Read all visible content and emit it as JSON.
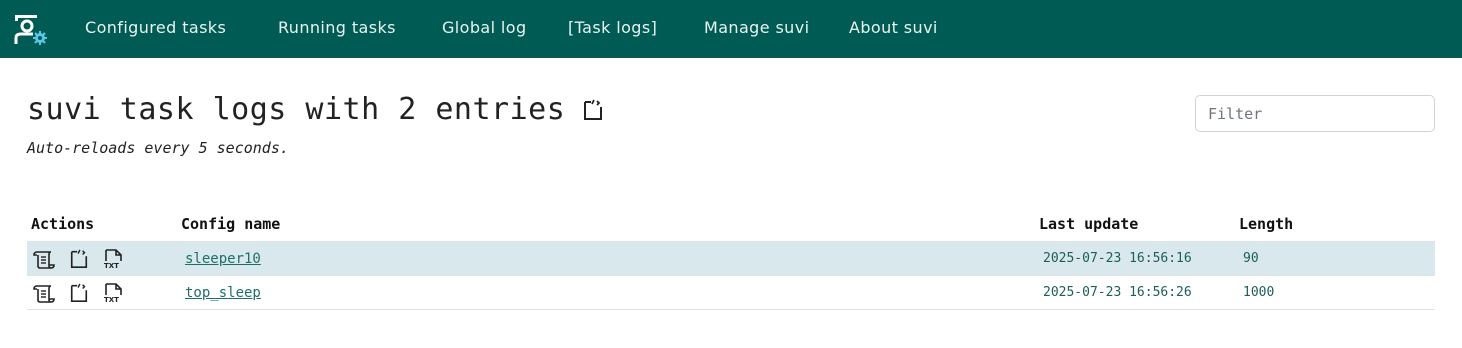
{
  "nav": {
    "items": [
      {
        "label": "Configured tasks"
      },
      {
        "label": "Running tasks"
      },
      {
        "label": "Global log"
      },
      {
        "label": "[Task logs]"
      },
      {
        "label": "Manage suvi"
      },
      {
        "label": "About suvi"
      }
    ]
  },
  "page": {
    "title": "suvi task logs with 2 entries",
    "subtitle": "Auto-reloads every 5 seconds.",
    "title_icon": "code-file-icon"
  },
  "filter": {
    "placeholder": "Filter"
  },
  "table": {
    "headers": [
      "Actions",
      "Config name",
      "Last update",
      "Length"
    ],
    "rows": [
      {
        "config": "sleeper10",
        "last_update": "2025-07-23 16:56:16",
        "length": "90"
      },
      {
        "config": "top_sleep",
        "last_update": "2025-07-23 16:56:26",
        "length": "1000"
      }
    ],
    "action_icons": [
      "log-scroll-icon",
      "code-file-icon",
      "txt-file-icon"
    ]
  },
  "colors": {
    "navbar": "#005b54",
    "stripe": "#d9e8ec",
    "link": "#1f6f69"
  }
}
